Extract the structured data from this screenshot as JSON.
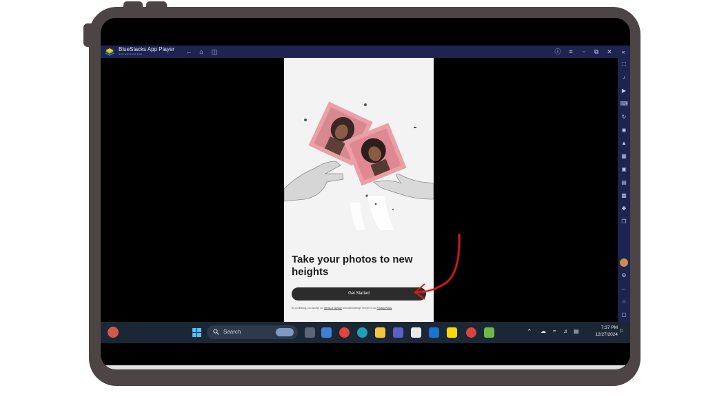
{
  "window": {
    "title": "BlueStacks App Player",
    "subtitle": "5.21.610.1019  P64"
  },
  "app": {
    "headline": "Take your photos to new heights",
    "cta_label": "Get Started",
    "legal_prefix": "By continuing, you accept our ",
    "legal_terms": "Terms of Service",
    "legal_middle": " and acknowledge receipt of our ",
    "legal_privacy": "Privacy Policy"
  },
  "taskbar": {
    "search_placeholder": "Search",
    "time": "7:37 PM",
    "date": "12/27/2024"
  },
  "colors": {
    "bluestacks_bar": "#1d2450",
    "taskbar": "#1c2735",
    "cta": "#2c2c2c",
    "annotation": "#e01818",
    "photo_pink": "#e9a0a6"
  },
  "icons": {
    "titlebar_left": [
      "back-icon",
      "home-icon",
      "multitask-icon"
    ],
    "titlebar_right": [
      "help-icon",
      "menu-icon",
      "minimize-icon",
      "restore-icon",
      "close-icon",
      "collapse-icon"
    ],
    "right_toolbar": [
      "fullscreen-icon",
      "volume-icon",
      "media-icon",
      "keyboard-icon",
      "rotate-icon",
      "record-icon",
      "install-apk-icon",
      "macro-icon",
      "screenshot-icon",
      "shake-icon",
      "gallery-icon",
      "location-icon",
      "copy-icon",
      "profile-avatar",
      "settings-icon",
      "back-icon",
      "home-icon",
      "recent-apps-icon"
    ],
    "taskbar_apps": [
      "task-view-icon",
      "widgets-icon",
      "chrome-icon",
      "edge-icon",
      "file-explorer-icon",
      "teams-icon",
      "store-icon",
      "mail-icon",
      "sticky-notes-icon",
      "chrome-alt-icon",
      "bluestacks-icon"
    ]
  }
}
